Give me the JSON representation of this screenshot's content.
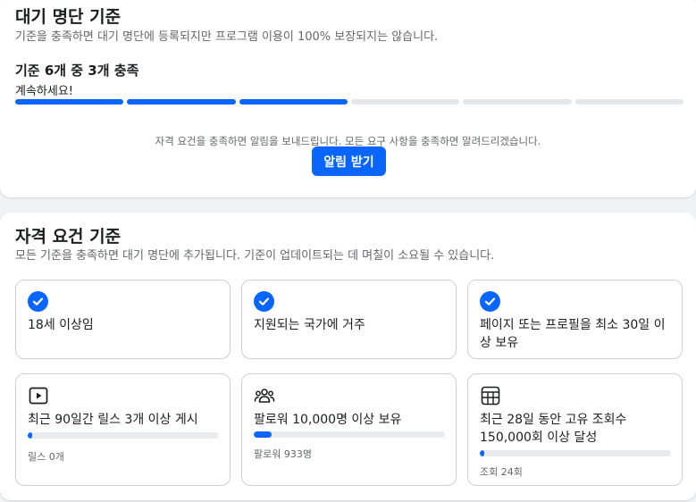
{
  "waitlist": {
    "title": "대기 명단 기준",
    "subtitle": "기준을 충족하면 대기 명단에 등록되지만 프로그램 이용이 100% 보장되지는 않습니다.",
    "progress_heading": "기준 6개 중 3개 충족",
    "progress_message": "계속하세요!",
    "criteria_total": 6,
    "criteria_met": 3,
    "notify_text": "자격 요건을 충족하면 알림을 보내드립니다. 모든 요구 사항을 충족하면 알려드리겠습니다.",
    "notify_button": "알림 받기"
  },
  "eligibility": {
    "title": "자격 요건 기준",
    "subtitle": "모든 기준을 충족하면 대기 명단에 추가됩니다. 기준이 업데이트되는 데 며칠이 소요될 수 있습니다.",
    "criteria": [
      {
        "label": "18세 이상임",
        "status": "met",
        "icon": "check-icon"
      },
      {
        "label": "지원되는 국가에 거주",
        "status": "met",
        "icon": "check-icon"
      },
      {
        "label": "페이지 또는 프로필을 최소 30일 이상 보유",
        "status": "met",
        "icon": "check-icon"
      },
      {
        "label": "최근 90일간 릴스 3개 이상 게시",
        "status": "in-progress",
        "icon": "video-play-icon",
        "caption": "릴스 0개",
        "progress": 0.02
      },
      {
        "label": "팔로워 10,000명 이상 보유",
        "status": "in-progress",
        "icon": "people-icon",
        "caption": "팔로워 933명",
        "progress": 0.093
      },
      {
        "label": "최근 28일 동안 고유 조회수 150,000회 이상 달성",
        "status": "in-progress",
        "icon": "grid-calendar-icon",
        "caption": "조회 24회",
        "progress": 0.01
      }
    ]
  },
  "colors": {
    "accent": "#0866ff",
    "track": "#e4e6eb",
    "secondary_text": "#65676b",
    "border": "#ced0d4"
  }
}
